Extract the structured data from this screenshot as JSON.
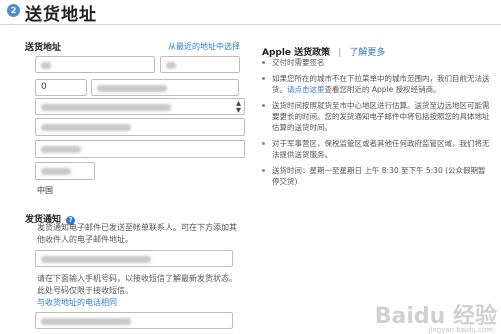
{
  "header": {
    "step": "2",
    "title": "送货地址"
  },
  "address": {
    "label": "送货地址",
    "pick_recent": "从最近的地址中选择",
    "country": "中国"
  },
  "policy": {
    "title": "Apple 送货政策",
    "separator": "|",
    "learn_more": "了解更多",
    "bullet_0": "交付时需要签名",
    "bullet_1_pre": "如果您所在的城市不在下拉菜单中的城市范围内，我们目前无法送货。",
    "bullet_1_link": "请点击这里",
    "bullet_1_post": "查看您附近的 Apple 授权经销商。",
    "bullet_2": "送货时间按照就货至市中心地区进行估算。送货至边远地区可能需要更长的时间。您的发货通知电子邮件中将包括按照您的具体地址估算的送货时间。",
    "bullet_3": "对于军事营区，保税监管区或者其他任何政府监管区域，我们将无法提供送货服务。",
    "bullet_4": "送货时间：星期一至星期日 上午 8:30 至下午 5:30 (公众假期暂停交货)"
  },
  "notify": {
    "label": "发货通知",
    "email_desc": "发货通知电子邮件已发送至帐单联系人。可在下方添加其他收件人的电子邮件地址。",
    "sms_desc": "请在下面输入手机号码，以接收短信了解最新发货状态。此处号码仅限于接收短信。",
    "same_phone_link": "与收货地址的电话相同"
  },
  "fields": {
    "area_code": "0"
  },
  "watermark": {
    "text": "Baidu 经验",
    "sub": "jingyan.baidu.com"
  }
}
